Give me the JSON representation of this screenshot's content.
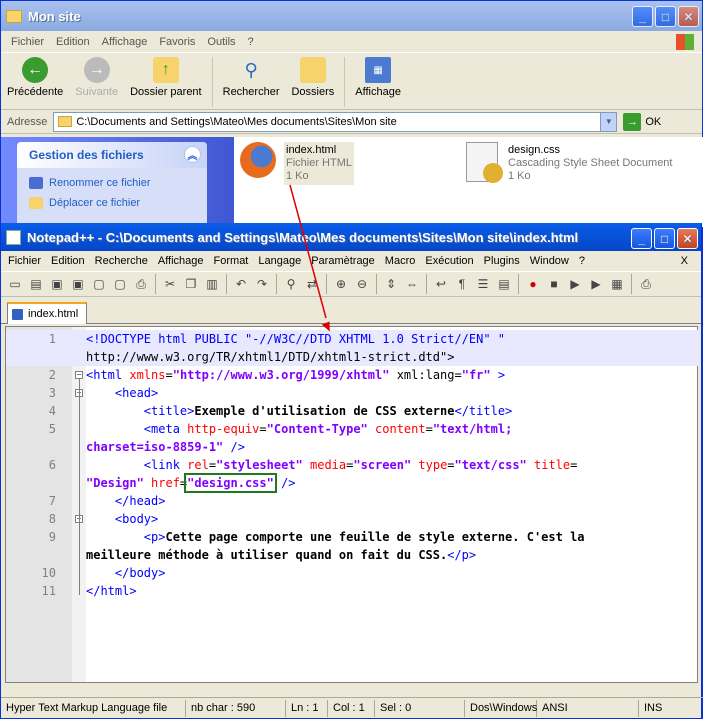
{
  "explorer": {
    "title": "Mon site",
    "menu": [
      "Fichier",
      "Edition",
      "Affichage",
      "Favoris",
      "Outils",
      "?"
    ],
    "toolbar": {
      "back": "Précédente",
      "forward": "Suivante",
      "parent": "Dossier parent",
      "search": "Rechercher",
      "folders": "Dossiers",
      "view": "Affichage"
    },
    "address_label": "Adresse",
    "address": "C:\\Documents and Settings\\Mateo\\Mes documents\\Sites\\Mon site",
    "go": "OK",
    "tasks": {
      "title": "Gestion des fichiers",
      "items": [
        "Renommer ce fichier",
        "Déplacer ce fichier"
      ]
    },
    "files": [
      {
        "name": "index.html",
        "type": "Fichier HTML",
        "size": "1 Ko",
        "icon": "firefox-html-icon"
      },
      {
        "name": "design.css",
        "type": "Cascading Style Sheet Document",
        "size": "1 Ko",
        "icon": "css-file-icon"
      }
    ]
  },
  "npp": {
    "title": "Notepad++ - C:\\Documents and Settings\\Mateo\\Mes documents\\Sites\\Mon site\\index.html",
    "menu": [
      "Fichier",
      "Edition",
      "Recherche",
      "Affichage",
      "Format",
      "Langage",
      "Paramètrage",
      "Macro",
      "Exécution",
      "Plugins",
      "Window",
      "?"
    ],
    "close_doc": "X",
    "tab": "index.html",
    "status": {
      "lang": "Hyper Text Markup Language file",
      "chars": "nb char : 590",
      "ln": "Ln : 1",
      "col": "Col : 1",
      "sel": "Sel : 0",
      "eol": "Dos\\Windows",
      "enc": "ANSI",
      "mode": "INS"
    }
  },
  "code_lines": [
    {
      "n": "1",
      "parts": [
        [
          "tg",
          "<!DOCTYPE html PUBLIC \"-//W3C//DTD XHTML 1.0 Strict//EN\" \""
        ]
      ]
    },
    {
      "n": "",
      "parts": [
        [
          "",
          "http://www.w3.org/TR/xhtml1/DTD/xhtml1-strict.dtd\">"
        ]
      ]
    },
    {
      "n": "2",
      "parts": [
        [
          "tg",
          "<html "
        ],
        [
          "at",
          "xmlns"
        ],
        [
          "",
          "="
        ],
        [
          "st",
          "\"http://www.w3.org/1999/xhtml\""
        ],
        [
          "",
          " xml:lang="
        ],
        [
          "st",
          "\"fr\""
        ],
        [
          "tg",
          " >"
        ]
      ]
    },
    {
      "n": "3",
      "parts": [
        [
          "",
          "    "
        ],
        [
          "tg",
          "<head>"
        ]
      ]
    },
    {
      "n": "4",
      "parts": [
        [
          "",
          "        "
        ],
        [
          "tg",
          "<title>"
        ],
        [
          "tx",
          "Exemple d'utilisation de CSS externe"
        ],
        [
          "tg",
          "</title>"
        ]
      ]
    },
    {
      "n": "5",
      "parts": [
        [
          "",
          "        "
        ],
        [
          "tg",
          "<meta "
        ],
        [
          "at",
          "http-equiv"
        ],
        [
          "",
          "="
        ],
        [
          "st",
          "\"Content-Type\""
        ],
        [
          "at",
          " content"
        ],
        [
          "",
          "="
        ],
        [
          "st",
          "\"text/html;"
        ]
      ]
    },
    {
      "n": "",
      "parts": [
        [
          "st",
          "charset=iso-8859-1\""
        ],
        [
          "tg",
          " />"
        ]
      ]
    },
    {
      "n": "6",
      "parts": [
        [
          "",
          "        "
        ],
        [
          "tg",
          "<link "
        ],
        [
          "at",
          "rel"
        ],
        [
          "",
          "="
        ],
        [
          "st",
          "\"stylesheet\""
        ],
        [
          "at",
          " media"
        ],
        [
          "",
          "="
        ],
        [
          "st",
          "\"screen\""
        ],
        [
          "at",
          " type"
        ],
        [
          "",
          "="
        ],
        [
          "st",
          "\"text/css\""
        ],
        [
          "at",
          " title"
        ],
        [
          "",
          "="
        ]
      ]
    },
    {
      "n": "",
      "parts": [
        [
          "st",
          "\"Design\""
        ],
        [
          "at",
          " href"
        ],
        [
          "",
          "="
        ],
        [
          "sth",
          "\"design.css\""
        ],
        [
          "tg",
          " />"
        ]
      ]
    },
    {
      "n": "7",
      "parts": [
        [
          "",
          "    "
        ],
        [
          "tg",
          "</head>"
        ]
      ]
    },
    {
      "n": "8",
      "parts": [
        [
          "",
          "    "
        ],
        [
          "tg",
          "<body>"
        ]
      ]
    },
    {
      "n": "9",
      "parts": [
        [
          "",
          "        "
        ],
        [
          "tg",
          "<p>"
        ],
        [
          "tx",
          "Cette page comporte une feuille de style externe. C'est la"
        ]
      ]
    },
    {
      "n": "",
      "parts": [
        [
          "tx",
          "meilleure méthode à utiliser quand on fait du CSS."
        ],
        [
          "tg",
          "</p>"
        ]
      ]
    },
    {
      "n": "10",
      "parts": [
        [
          "",
          "    "
        ],
        [
          "tg",
          "</body>"
        ]
      ]
    },
    {
      "n": "11",
      "parts": [
        [
          "tg",
          "</html>"
        ]
      ]
    }
  ]
}
